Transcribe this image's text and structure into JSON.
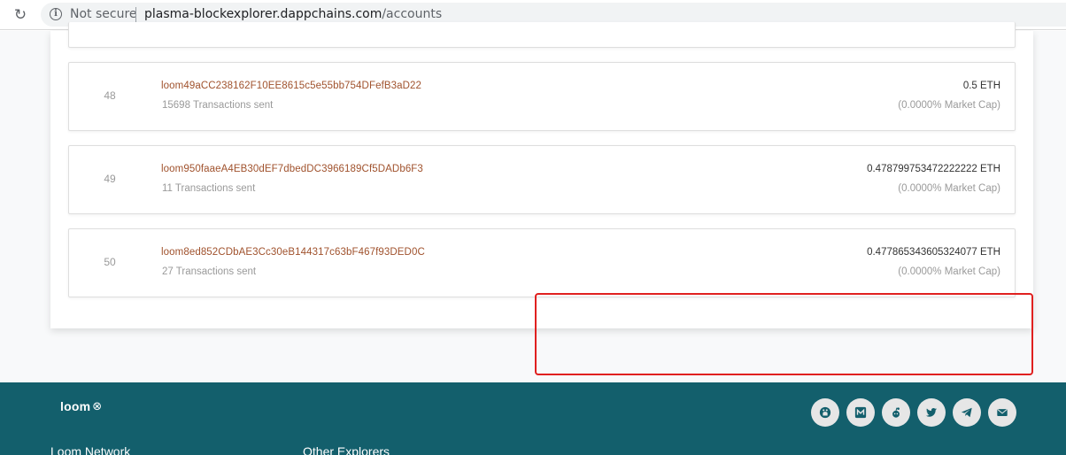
{
  "browser": {
    "reload_icon": "reload-icon",
    "info_icon": "info-icon",
    "security_label": "Not secure",
    "url_host": "plasma-blockexplorer.dappchains.com",
    "url_path": "/accounts"
  },
  "accounts": [
    {
      "rank": "48",
      "address": "loom49aCC238162F10EE8615c5e55bb754DFefB3aD22",
      "transactions": "15698 Transactions sent",
      "balance": "0.5 ETH",
      "market_cap": "(0.0000% Market Cap)"
    },
    {
      "rank": "49",
      "address": "loom950faaeA4EB30dEF7dbedDC3966189Cf5DADb6F3",
      "transactions": "11 Transactions sent",
      "balance": "0.478799753472222222 ETH",
      "market_cap": "(0.0000% Market Cap)"
    },
    {
      "rank": "50",
      "address": "loom8ed852CDbAE3Cc30eB144317c63bF467f93DED0C",
      "transactions": "27 Transactions sent",
      "balance": "0.477865343605324077 ETH",
      "market_cap": "(0.0000% Market Cap)"
    }
  ],
  "footer": {
    "logo_text": "loom",
    "logo_mark": "⊗",
    "headings": [
      "Loom Network",
      "Other Explorers"
    ],
    "social_icons": [
      "github-icon",
      "medium-icon",
      "reddit-icon",
      "twitter-icon",
      "telegram-icon",
      "email-icon"
    ]
  },
  "colors": {
    "address": "#a0522d",
    "footer_bg": "#135f6c",
    "highlight": "#e0201f"
  }
}
